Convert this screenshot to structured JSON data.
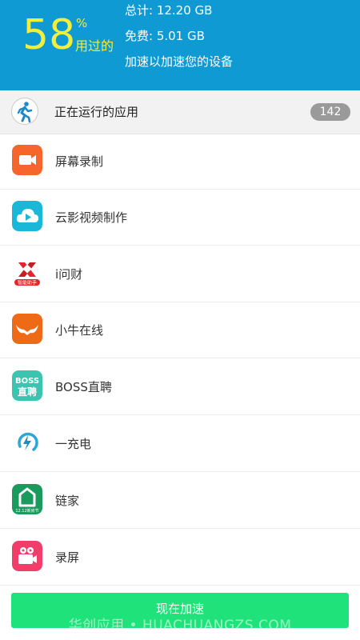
{
  "header": {
    "percent": "58",
    "percent_sign": "%",
    "percent_label": "用过的",
    "total": "总计:  12.20 GB",
    "free": "免费:  5.01 GB",
    "hint": "加速以加速您的设备"
  },
  "running": {
    "label": "正在运行的应用",
    "count": "142",
    "icon": "running-person-icon"
  },
  "apps": [
    {
      "name": "屏幕录制",
      "icon": "video-camera-icon",
      "color": "#f5652c"
    },
    {
      "name": "云影视频制作",
      "icon": "cloud-play-icon",
      "color": "#1bb7d8"
    },
    {
      "name": "i问财",
      "icon": "iwencai-logo-icon",
      "color": "#e4262c",
      "badge": "智能助手"
    },
    {
      "name": "小牛在线",
      "icon": "bull-horns-icon",
      "color": "#ef6a17"
    },
    {
      "name": "BOSS直聘",
      "icon": "boss-logo-icon",
      "color": "#3bc5b1",
      "badge": "BOSS",
      "badge2": "直聘"
    },
    {
      "name": "一充电",
      "icon": "charge-logo-icon",
      "color": "#1ba3cf"
    },
    {
      "name": "链家",
      "icon": "house-icon",
      "color": "#1a9b5d",
      "badge": "12.12新房节"
    },
    {
      "name": "录屏",
      "icon": "film-camera-icon",
      "color": "#f03d6a"
    }
  ],
  "action": {
    "label": "现在加速"
  },
  "watermark": "华创应用 • HUACHUANGZS.COM",
  "colors": {
    "header_bg": "#0f9ad3",
    "percent": "#f2ef3c",
    "button": "#1fe37a"
  }
}
